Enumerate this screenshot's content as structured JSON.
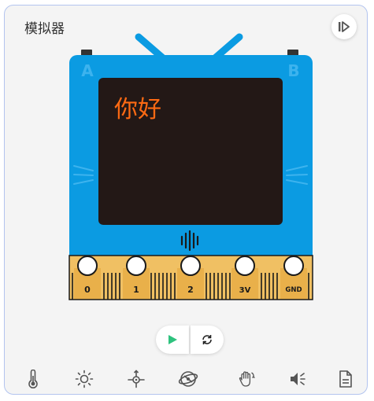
{
  "panel": {
    "title": "模拟器"
  },
  "device": {
    "button_a": "A",
    "button_b": "B",
    "screen_text": "你好",
    "screen_text_color": "#ff6a13",
    "body_color": "#0b9be2",
    "screen_color": "#231816",
    "pins": [
      "0",
      "1",
      "2",
      "3V",
      "GND"
    ]
  },
  "controls": {
    "play_icon": "play-icon",
    "reset_icon": "refresh-icon"
  },
  "toolbar": {
    "icons": [
      "thermometer-icon",
      "brightness-icon",
      "compass-icon",
      "gyroscope-icon",
      "hand-gesture-icon",
      "speaker-icon",
      "document-icon"
    ]
  }
}
